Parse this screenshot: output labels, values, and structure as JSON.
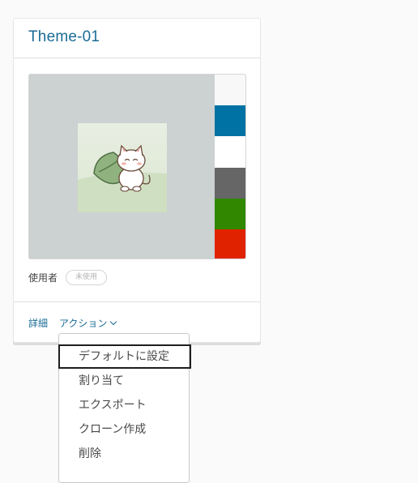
{
  "card": {
    "title": "Theme-01",
    "users_label": "使用者",
    "users_badge": "未使用",
    "details_link": "詳細",
    "actions_label": "アクション"
  },
  "preview": {
    "background_color": "#ccd1d1",
    "thumbnail": "cat-with-leaf-illustration",
    "swatches": [
      "#f8f8f8",
      "#0072a3",
      "#ffffff",
      "#666666",
      "#318700",
      "#e12200"
    ]
  },
  "actions_menu": {
    "items": [
      "デフォルトに設定",
      "割り当て",
      "エクスポート",
      "クローン作成",
      "削除"
    ],
    "focused_item": "デフォルトに設定"
  },
  "colors": {
    "accent": "#1a6c96"
  }
}
